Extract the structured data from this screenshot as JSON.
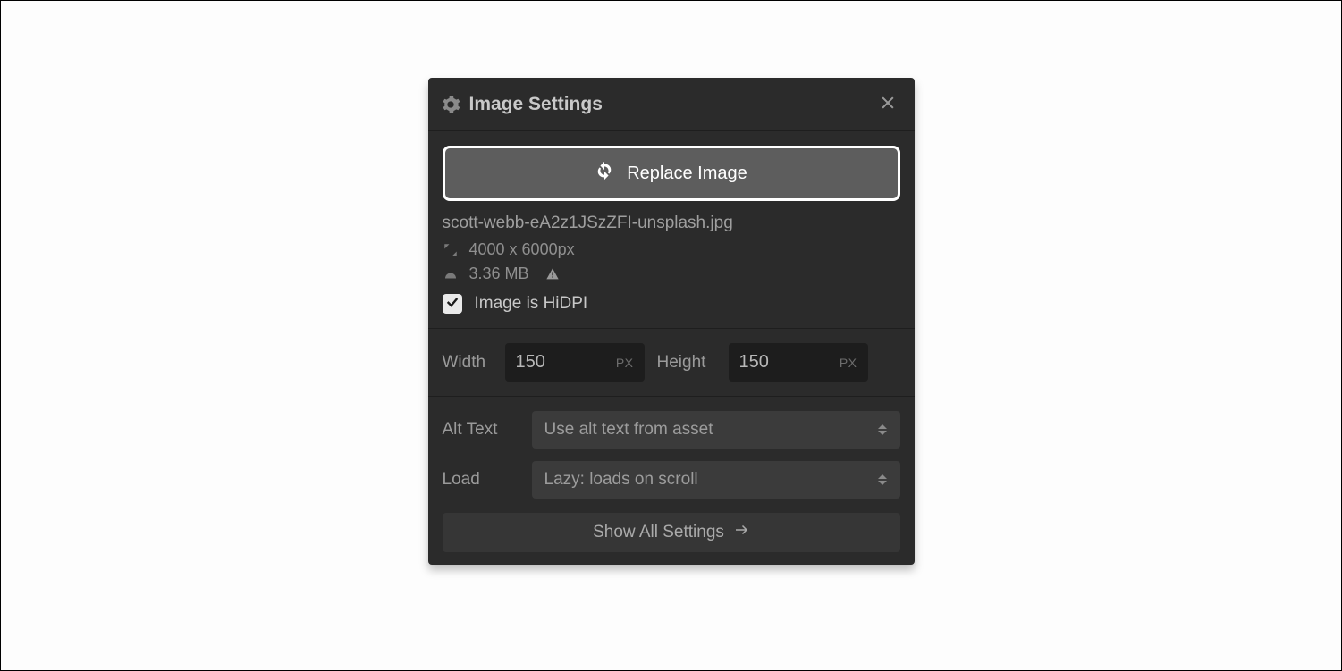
{
  "header": {
    "title": "Image Settings"
  },
  "replace": {
    "label": "Replace Image"
  },
  "file": {
    "name": "scott-webb-eA2z1JSzZFI-unsplash.jpg",
    "dimensions": "4000 x 6000px",
    "size": "3.36 MB",
    "hidpi_label": "Image is HiDPI",
    "hidpi_checked": true
  },
  "size_fields": {
    "width_label": "Width",
    "width_value": "150",
    "width_unit": "PX",
    "height_label": "Height",
    "height_value": "150",
    "height_unit": "PX"
  },
  "selects": {
    "alt_label": "Alt Text",
    "alt_value": "Use alt text from asset",
    "load_label": "Load",
    "load_value": "Lazy: loads on scroll"
  },
  "footer": {
    "show_all": "Show All Settings"
  }
}
